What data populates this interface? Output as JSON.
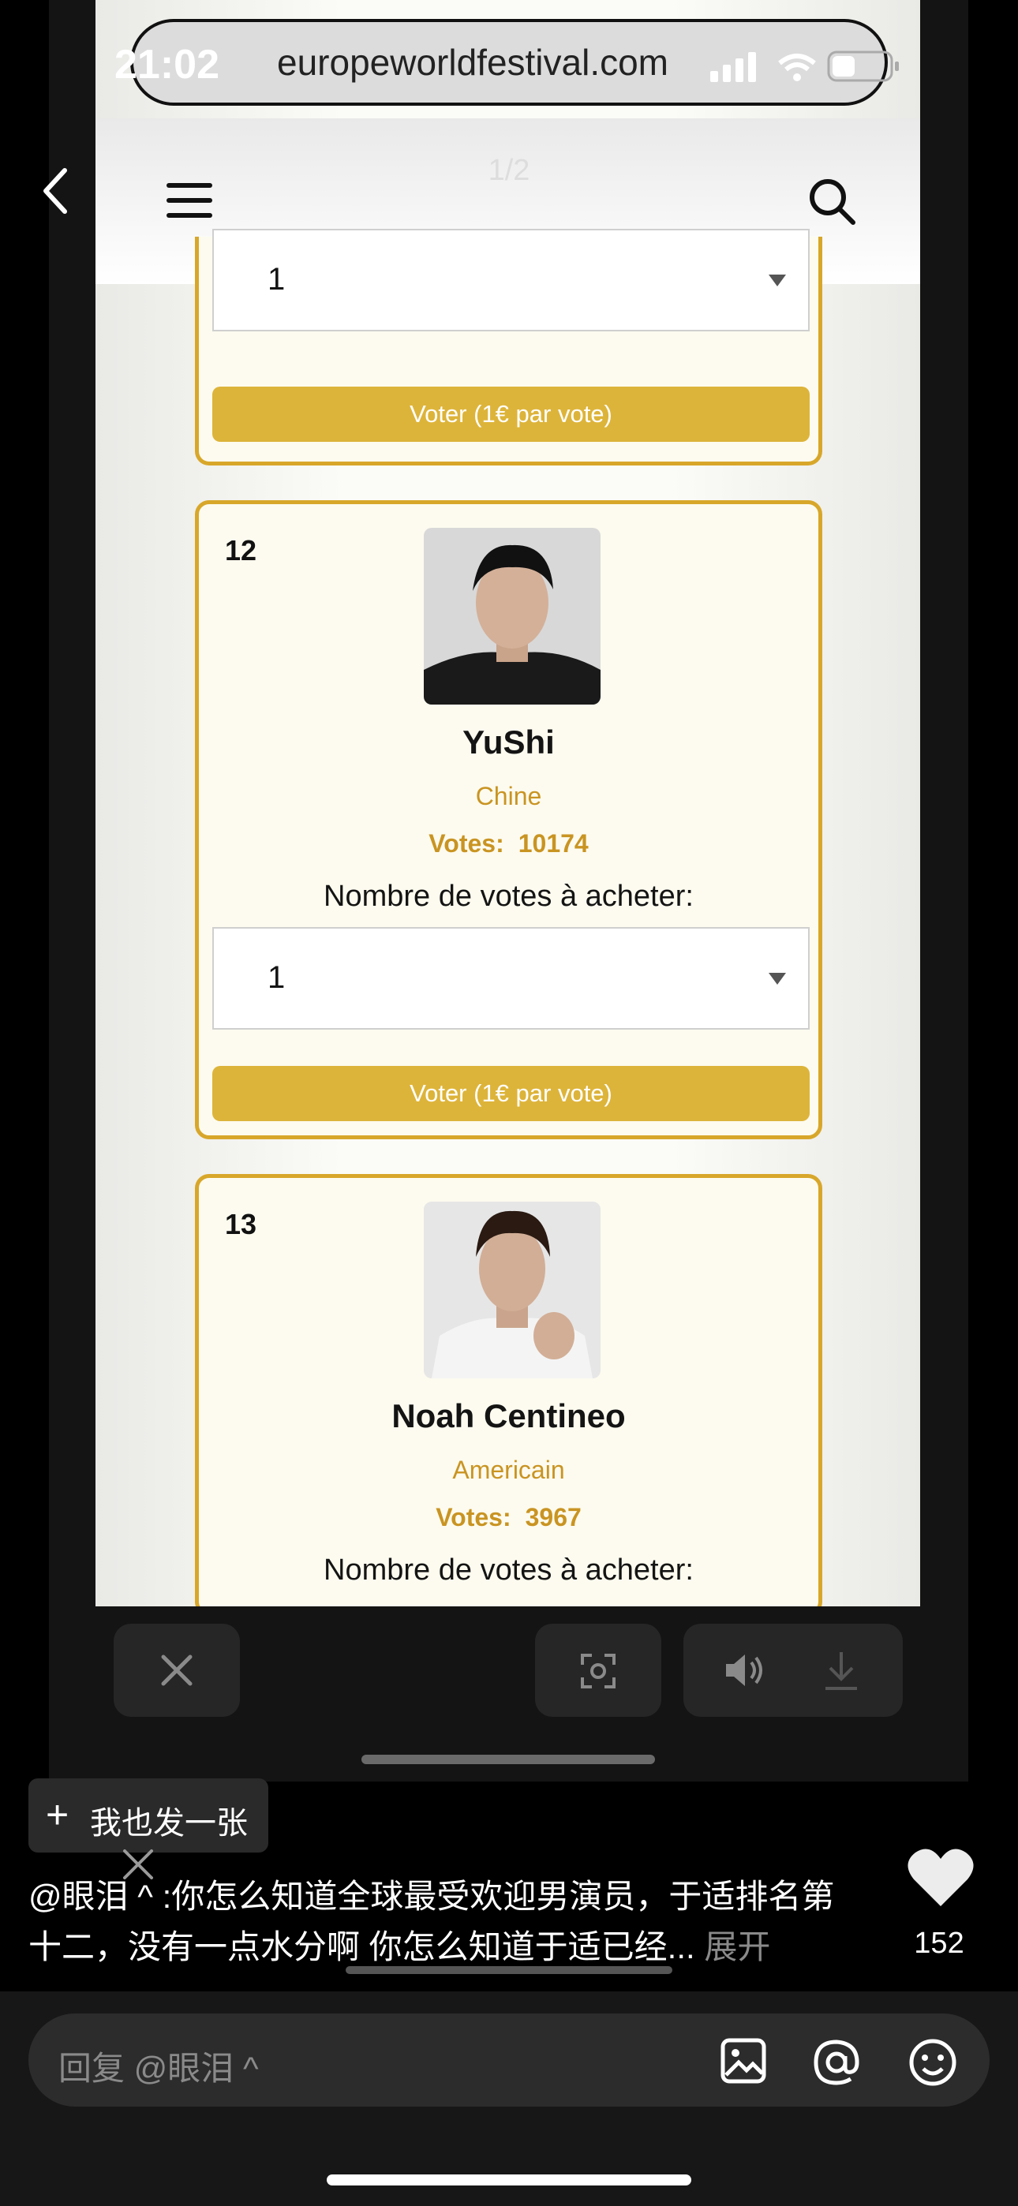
{
  "status_bar": {
    "time": "21:02"
  },
  "viewer": {
    "page_counter": "1/2"
  },
  "browser": {
    "url": "europeworldfestival.com"
  },
  "cards": [
    {
      "select_value": "1",
      "vote_button": "Voter (1€ par vote)"
    },
    {
      "rank": "12",
      "name": "YuShi",
      "country": "Chine",
      "votes_label": "Votes:",
      "votes": "10174",
      "buy_label": "Nombre de votes à acheter:",
      "select_value": "1",
      "vote_button": "Voter (1€ par vote)"
    },
    {
      "rank": "13",
      "name": "Noah Centineo",
      "country": "Americain",
      "votes_label": "Votes:",
      "votes": "3967",
      "buy_label": "Nombre de votes à acheter:"
    }
  ],
  "post_button": {
    "icon": "+",
    "label": "我也发一张"
  },
  "caption": {
    "text": "@眼泪 ^ :你怎么知道全球最受欢迎男演员，于适排名第十二，没有一点水分啊 你怎么知道于适已经...",
    "more": "展开"
  },
  "likes": "152",
  "reply": {
    "placeholder": "回复 @眼泪 ^"
  },
  "colors": {
    "gold": "#d8a72a",
    "button": "#ddb43a"
  }
}
